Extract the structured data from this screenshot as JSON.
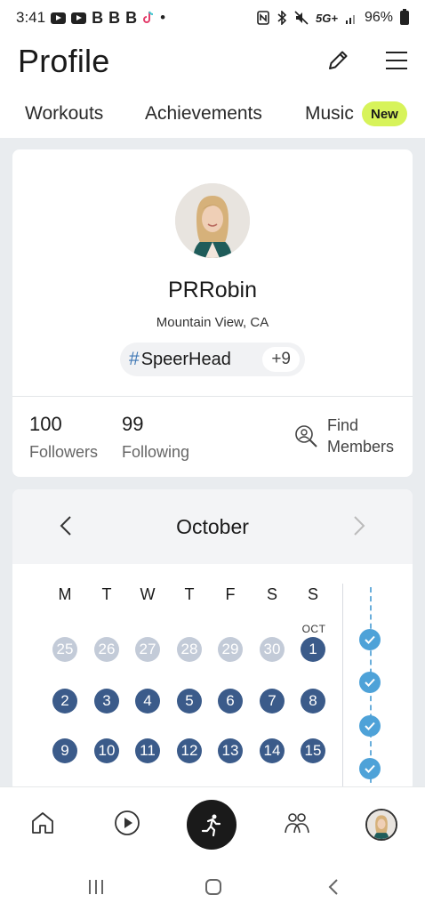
{
  "status_bar": {
    "time": "3:41",
    "b_letters": [
      "B",
      "B",
      "B"
    ],
    "network": "5G+",
    "battery": "96%"
  },
  "header": {
    "title": "Profile",
    "tabs": [
      {
        "label": "Workouts"
      },
      {
        "label": "Achievements"
      },
      {
        "label": "Music",
        "badge": "New"
      }
    ]
  },
  "profile": {
    "username": "PRRobin",
    "location": "Mountain View, CA",
    "hashtag": "SpeerHead",
    "hashtag_symbol": "#",
    "hashtag_more": "+9",
    "followers_count": "100",
    "followers_label": "Followers",
    "following_count": "99",
    "following_label": "Following",
    "find_members_line1": "Find",
    "find_members_line2": "Members"
  },
  "calendar": {
    "month": "October",
    "weekdays": [
      "M",
      "T",
      "W",
      "T",
      "F",
      "S",
      "S"
    ],
    "month_marker": "OCT",
    "prev_month_days": [
      "25",
      "26",
      "27",
      "28",
      "29",
      "30"
    ],
    "days": [
      "1",
      "2",
      "3",
      "4",
      "5",
      "6",
      "7",
      "8",
      "9",
      "10",
      "11",
      "12",
      "13",
      "14",
      "15"
    ]
  },
  "colors": {
    "accent_badge": "#d7f35a",
    "day_circle": "#3b5b8a",
    "prev_day_circle": "#c3cbd8",
    "check": "#4ea2d8"
  },
  "icons": {
    "edit": "pencil-icon",
    "menu": "hamburger-menu-icon",
    "find": "search-person-icon",
    "home": "home-icon",
    "play": "play-icon",
    "record": "runner-icon",
    "groups": "groups-icon"
  }
}
